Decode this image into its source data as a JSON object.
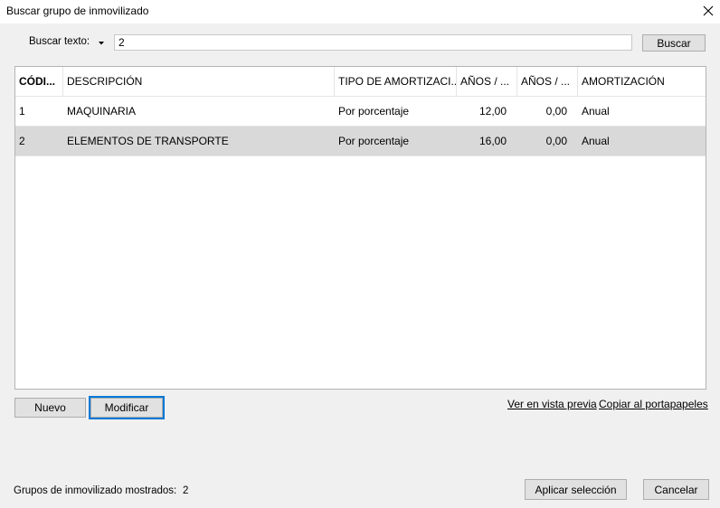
{
  "window": {
    "title": "Buscar grupo de inmovilizado",
    "close_icon": "close-icon"
  },
  "search": {
    "label": "Buscar texto:",
    "value": "2",
    "button": "Buscar"
  },
  "grid": {
    "columns": [
      "CÓDI...",
      "DESCRIPCIÓN",
      "TIPO DE AMORTIZACI...",
      "AÑOS / ...",
      "AÑOS / ...",
      "AMORTIZACIÓN"
    ],
    "rows": [
      {
        "codigo": "1",
        "descripcion": "MAQUINARIA",
        "tipo": "Por porcentaje",
        "anios1": "12,00",
        "anios2": "0,00",
        "amortizacion": "Anual",
        "selected": false
      },
      {
        "codigo": "2",
        "descripcion": "ELEMENTOS DE TRANSPORTE",
        "tipo": "Por porcentaje",
        "anios1": "16,00",
        "anios2": "0,00",
        "amortizacion": "Anual",
        "selected": true
      }
    ]
  },
  "actions": {
    "nuevo": "Nuevo",
    "modificar": "Modificar",
    "vista_previa": "Ver en vista previa",
    "copiar": "Copiar al portapapeles"
  },
  "status": {
    "label": "Grupos de inmovilizado mostrados:",
    "count": "2"
  },
  "footer": {
    "aplicar": "Aplicar selección",
    "cancelar": "Cancelar"
  },
  "colors": {
    "selected_row": "#d9d9d9",
    "focus_border": "#0078d7"
  }
}
